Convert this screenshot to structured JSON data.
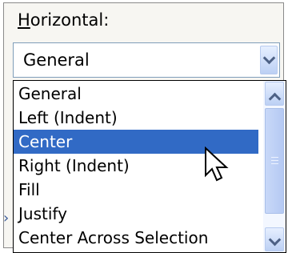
{
  "horizontal": {
    "label": "Horizontal:",
    "label_access_key": "H",
    "label_rest": "orizontal:",
    "combo_value": "General",
    "dropdown_icon": "chevron-down-icon",
    "options": [
      "General",
      "Left (Indent)",
      "Center",
      "Right (Indent)",
      "Fill",
      "Justify",
      "Center Across Selection"
    ],
    "highlighted_option": "Center"
  },
  "colors": {
    "selection": "#316ac5",
    "scroll_button": "#bcd0f4"
  },
  "pointer_icon": "arrow-cursor-icon"
}
